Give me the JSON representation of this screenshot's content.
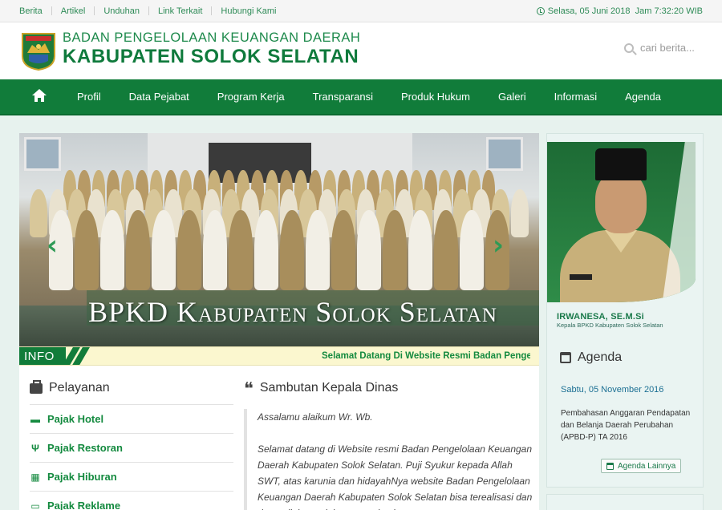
{
  "topbar": {
    "links": [
      "Berita",
      "Artikel",
      "Unduhan",
      "Link Terkait",
      "Hubungi Kami"
    ],
    "datetime": "Selasa, 05 Juni 2018  Jam 7:32:20 WIB"
  },
  "header": {
    "title_line1": "BADAN PENGELOLAAN KEUANGAN DAERAH",
    "title_line2": "KABUPATEN SOLOK SELATAN",
    "search_placeholder": "cari berita..."
  },
  "nav": {
    "items": [
      "Profil",
      "Data Pejabat",
      "Program Kerja",
      "Transparansi",
      "Produk Hukum",
      "Galeri",
      "Informasi",
      "Agenda"
    ]
  },
  "slider": {
    "caption": "BPKD Kabupaten Solok Selatan",
    "prev": "‹",
    "next": "›"
  },
  "info": {
    "label": "INFO",
    "ticker": "Selamat Datang Di Website Resmi Badan Pengelolaan Keuangan Daerah"
  },
  "pelayanan": {
    "title": "Pelayanan",
    "items": [
      {
        "label": "Pajak Hotel",
        "icon": "bed-icon"
      },
      {
        "label": "Pajak Restoran",
        "icon": "cutlery-icon"
      },
      {
        "label": "Pajak Hiburan",
        "icon": "film-icon"
      },
      {
        "label": "Pajak Reklame",
        "icon": "board-icon"
      }
    ]
  },
  "sambutan": {
    "title": "Sambutan Kepala Dinas",
    "greeting": "Assalamu alaikum Wr. Wb.",
    "body": "Selamat datang di Website resmi Badan Pengelolaan Keuangan Daerah Kabupaten Solok Selatan. Puji Syukur kepada Allah SWT, atas karunia dan hidayahNya website Badan Pengelolaan Keuangan Daerah Kabupaten Solok Selatan bisa terealisasi dan dapat diakses oleh masyarakat luas."
  },
  "sidebar": {
    "official_name": "IRWANESA, SE.M.Si",
    "official_title": "Kepala BPKD Kabupaten Solok Selatan",
    "agenda_title": "Agenda",
    "agenda_date": "Sabtu, 05 November 2016",
    "agenda_desc": "Pembahasan Anggaran Pendapatan dan Belanja Daerah Perubahan (APBD-P) TA 2016",
    "agenda_button": "Agenda Lainnya"
  },
  "colors": {
    "brand_green": "#117c3a",
    "text_green": "#148a3f",
    "info_bg": "#fbf7cf"
  }
}
